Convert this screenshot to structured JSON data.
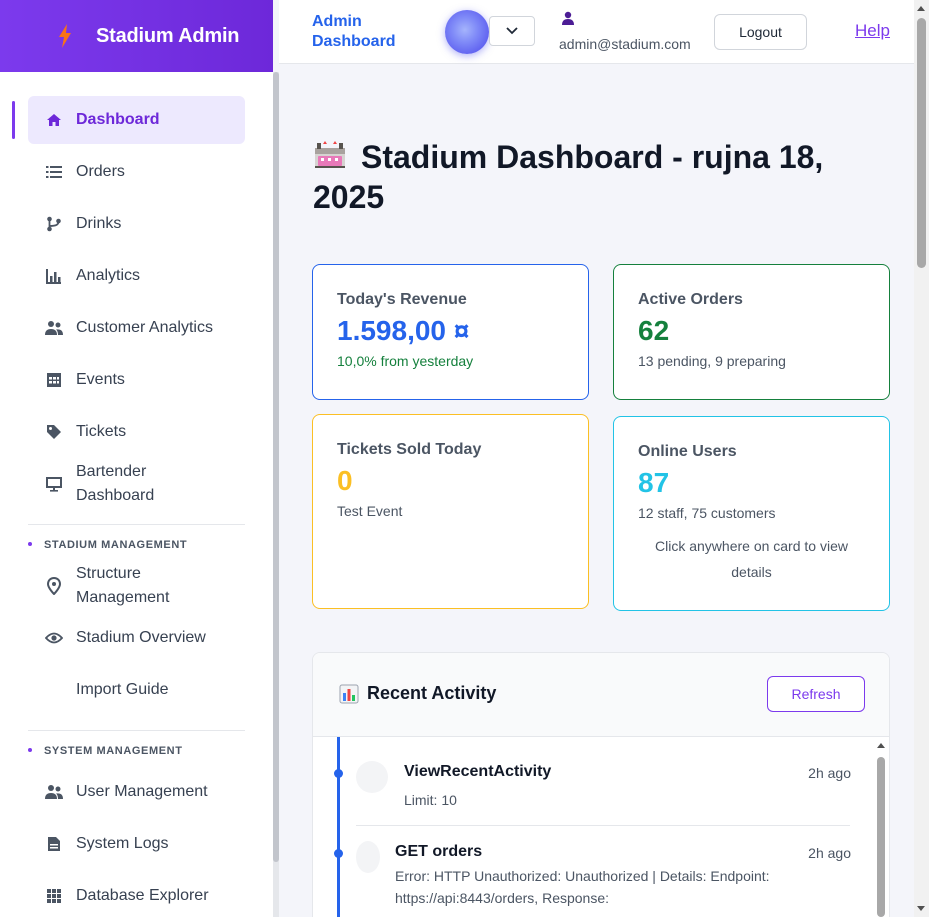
{
  "sidebar": {
    "brand": "Stadium Admin",
    "items": [
      {
        "label": "Dashboard",
        "icon": "home-icon"
      },
      {
        "label": "Orders",
        "icon": "list-icon"
      },
      {
        "label": "Drinks",
        "icon": "branch-icon"
      },
      {
        "label": "Analytics",
        "icon": "bar-chart-icon"
      },
      {
        "label": "Customer Analytics",
        "icon": "users-icon"
      },
      {
        "label": "Events",
        "icon": "calendar-grid-icon"
      },
      {
        "label": "Tickets",
        "icon": "tag-icon"
      },
      {
        "label": "Bartender Dashboard",
        "icon": "monitor-icon"
      }
    ],
    "stadium_section": {
      "heading": "STADIUM MANAGEMENT",
      "items": [
        {
          "label": "Structure Management",
          "icon": "map-pin-icon"
        },
        {
          "label": "Stadium Overview",
          "icon": "eye-icon"
        },
        {
          "label": "Import Guide",
          "icon": ""
        }
      ]
    },
    "system_section": {
      "heading": "SYSTEM MANAGEMENT",
      "items": [
        {
          "label": "User Management",
          "icon": "users-icon"
        },
        {
          "label": "System Logs",
          "icon": "document-icon"
        },
        {
          "label": "Database Explorer",
          "icon": "grid-icon"
        }
      ]
    }
  },
  "topbar": {
    "title": "Admin Dashboard",
    "user_email": "admin@stadium.com",
    "logout_label": "Logout",
    "help_label": "Help"
  },
  "page": {
    "title": "Stadium Dashboard - rujna 18, 2025"
  },
  "stats": {
    "revenue": {
      "label": "Today's Revenue",
      "value": "1.598,00 ¤",
      "sub": "10,0% from yesterday",
      "color": "#2563eb"
    },
    "orders": {
      "label": "Active Orders",
      "value": "62",
      "sub": "13 pending, 9 preparing",
      "color": "#15803d"
    },
    "tickets": {
      "label": "Tickets Sold Today",
      "value": "0",
      "sub": "Test Event",
      "color": "#fbbf24"
    },
    "online": {
      "label": "Online Users",
      "value": "87",
      "sub": "12 staff, 75 customers",
      "hint": "Click anywhere on card to view details",
      "color": "#22c3e6"
    }
  },
  "activity": {
    "title": "Recent Activity",
    "refresh_label": "Refresh",
    "items": [
      {
        "name": "ViewRecentActivity",
        "time": "2h ago",
        "detail": "Limit: 10"
      },
      {
        "name": "GET orders",
        "time": "2h ago",
        "detail": "Error: HTTP Unauthorized: Unauthorized | Details: Endpoint: https://api:8443/orders, Response:"
      }
    ]
  }
}
